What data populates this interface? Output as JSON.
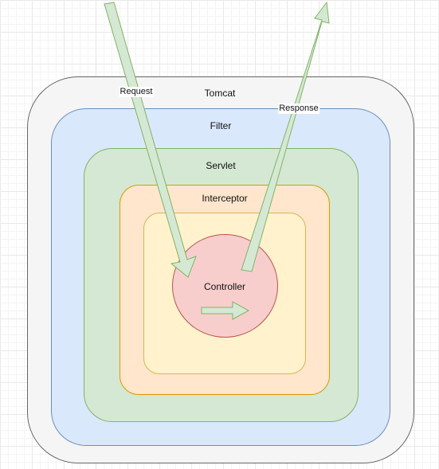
{
  "layers": {
    "tomcat": "Tomcat",
    "filter": "Filter",
    "servlet": "Servlet",
    "interceptor": "Interceptor",
    "controller": "Controller"
  },
  "flows": {
    "request": "Request",
    "response": "Response"
  },
  "colors": {
    "tomcat_fill": "#f5f5f5",
    "tomcat_stroke": "#666666",
    "filter_fill": "#dae8fc",
    "filter_stroke": "#6c8ebf",
    "servlet_fill": "#d5e8d4",
    "servlet_stroke": "#82b366",
    "interceptor_fill": "#ffe6cc",
    "interceptor_stroke": "#d79b00",
    "inner_fill": "#fff2cc",
    "inner_stroke": "#d6b656",
    "controller_fill": "#f8cecc",
    "controller_stroke": "#b85450",
    "arrow_fill": "#d5e8d4",
    "arrow_stroke": "#82b366"
  }
}
